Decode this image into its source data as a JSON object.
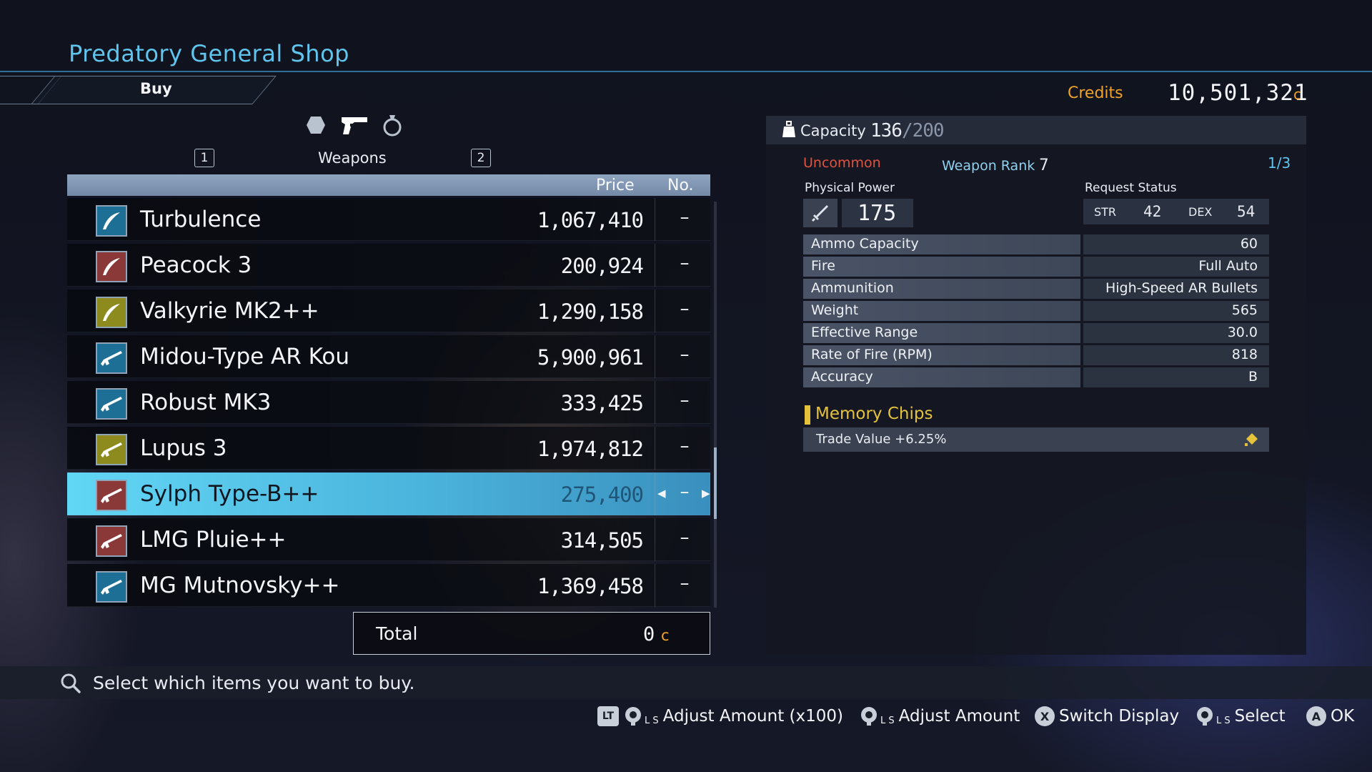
{
  "header": {
    "title": "Predatory General Shop",
    "tab_label": "Buy",
    "credits_label": "Credits",
    "credits_value": "10,501,321",
    "credits_unit": "c"
  },
  "category": {
    "key_left": "1",
    "key_right": "2",
    "label": "Weapons",
    "icons": [
      "accessory-hexagon-icon",
      "gun-icon",
      "ring-icon"
    ],
    "active_index": 1
  },
  "list": {
    "price_header": "Price",
    "no_header": "No.",
    "items": [
      {
        "name": "Turbulence",
        "price": "1,067,410",
        "qty": "–",
        "color": "blue",
        "icon": "blade-icon"
      },
      {
        "name": "Peacock 3",
        "price": "200,924",
        "qty": "–",
        "color": "red",
        "icon": "blade-icon"
      },
      {
        "name": "Valkyrie MK2++",
        "price": "1,290,158",
        "qty": "–",
        "color": "yellow",
        "icon": "blade-icon"
      },
      {
        "name": "Midou-Type AR Kou",
        "price": "5,900,961",
        "qty": "–",
        "color": "blue",
        "icon": "rifle-icon"
      },
      {
        "name": "Robust MK3",
        "price": "333,425",
        "qty": "–",
        "color": "blue",
        "icon": "rifle-icon"
      },
      {
        "name": "Lupus 3",
        "price": "1,974,812",
        "qty": "–",
        "color": "yellow",
        "icon": "rifle-icon"
      },
      {
        "name": "Sylph Type-B++",
        "price": "275,400",
        "qty": "–",
        "color": "red",
        "icon": "rifle-icon",
        "selected": true
      },
      {
        "name": "LMG Pluie++",
        "price": "314,505",
        "qty": "–",
        "color": "red",
        "icon": "rifle-icon"
      },
      {
        "name": "MG Mutnovsky++",
        "price": "1,369,458",
        "qty": "–",
        "color": "blue",
        "icon": "rifle-icon"
      }
    ],
    "total_label": "Total",
    "total_value": "0",
    "total_unit": "c"
  },
  "detail": {
    "capacity_label": "Capacity",
    "capacity_current": "136",
    "capacity_max": "/200",
    "rarity": "Uncommon",
    "weapon_rank_label": "Weapon Rank",
    "weapon_rank": "7",
    "page": "1/3",
    "physical_power_label": "Physical Power",
    "physical_power": "175",
    "request_status_label": "Request Status",
    "str_label": "STR",
    "str_value": "42",
    "dex_label": "DEX",
    "dex_value": "54",
    "stats": [
      {
        "name": "Ammo Capacity",
        "value": "60"
      },
      {
        "name": "Fire",
        "value": "Full Auto"
      },
      {
        "name": "Ammunition",
        "value": "High-Speed AR Bullets"
      },
      {
        "name": "Weight",
        "value": "565"
      },
      {
        "name": "Effective Range",
        "value": "30.0"
      },
      {
        "name": "Rate of Fire (RPM)",
        "value": "818"
      },
      {
        "name": "Accuracy",
        "value": "B"
      }
    ],
    "memory_chips_label": "Memory Chips",
    "memory_chip": "Trade Value +6.25%"
  },
  "help": {
    "text": "Select which items you want to buy."
  },
  "controls": {
    "adjust_100_button": "LT",
    "adjust_100_label": "Adjust Amount (x100)",
    "adjust_label": "Adjust Amount",
    "switch_button": "X",
    "switch_label": "Switch Display",
    "select_label": "Select",
    "ok_button": "A",
    "ok_label": "OK",
    "stick_label": "L S"
  },
  "colors": {
    "accent_cyan": "#5fc4ee",
    "credits_orange": "#f0a22a",
    "rarity_red": "#e0533f",
    "chips_yellow": "#e4c23b",
    "selected_row": "#4bb4dc"
  }
}
